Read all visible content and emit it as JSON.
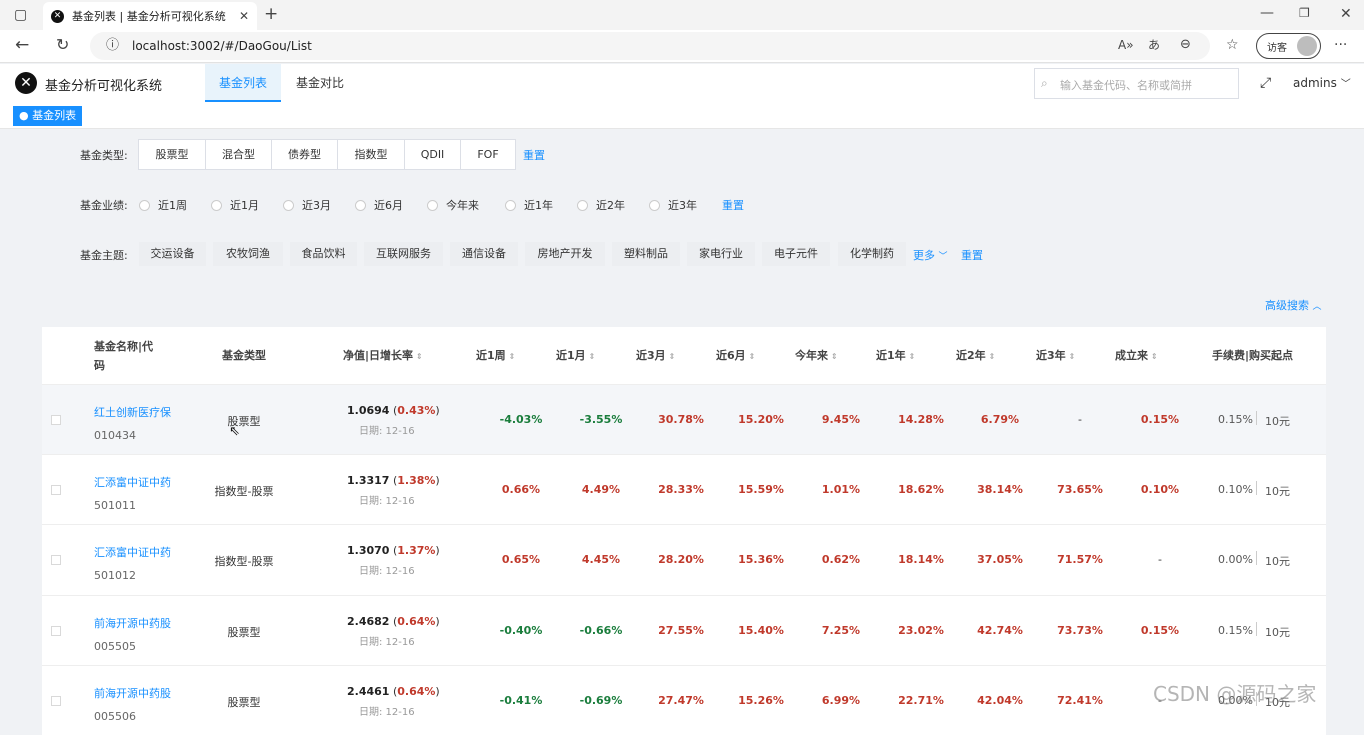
{
  "browser": {
    "tab_title": "基金列表 | 基金分析可视化系统",
    "url": "localhost:3002/#/DaoGou/List",
    "guest_label": "访客"
  },
  "app": {
    "title": "基金分析可视化系统",
    "nav": [
      "基金列表",
      "基金对比"
    ],
    "search_placeholder": "输入基金代码、名称或简拼",
    "user": "admins",
    "breadcrumb": "● 基金列表"
  },
  "filters": {
    "type_label": "基金类型:",
    "types": [
      "股票型",
      "混合型",
      "债券型",
      "指数型",
      "QDII",
      "FOF"
    ],
    "reset": "重置",
    "perf_label": "基金业绩:",
    "periods": [
      "近1周",
      "近1月",
      "近3月",
      "近6月",
      "今年来",
      "近1年",
      "近2年",
      "近3年"
    ],
    "theme_label": "基金主题:",
    "themes": [
      "交运设备",
      "农牧饲渔",
      "食品饮料",
      "互联网服务",
      "通信设备",
      "房地产开发",
      "塑料制品",
      "家电行业",
      "电子元件",
      "化学制药"
    ],
    "more": "更多",
    "advanced": "高级搜索"
  },
  "table": {
    "headers": [
      "基金名称|代",
      "码",
      "基金类型",
      "净值|日增长率",
      "近1周",
      "近1月",
      "近3月",
      "近6月",
      "今年来",
      "近1年",
      "近2年",
      "近3年",
      "成立来",
      "手续费|购买起点"
    ],
    "rows": [
      {
        "name": "红土创新医疗保",
        "code": "010434",
        "type": "股票型",
        "nav": "1.0694",
        "chg": "0.43%",
        "date": "日期: 12-16",
        "w1": "-4.03%",
        "m1": "-3.55%",
        "m3": "30.78%",
        "m6": "15.20%",
        "ytd": "9.45%",
        "y1": "14.28%",
        "y2": "6.79%",
        "y3": "-",
        "since": "0.15%",
        "fee": "0.15%",
        "min": "10元"
      },
      {
        "name": "汇添富中证中药",
        "code": "501011",
        "type": "指数型-股票",
        "nav": "1.3317",
        "chg": "1.38%",
        "date": "日期: 12-16",
        "w1": "0.66%",
        "m1": "4.49%",
        "m3": "28.33%",
        "m6": "15.59%",
        "ytd": "1.01%",
        "y1": "18.62%",
        "y2": "38.14%",
        "y3": "73.65%",
        "since": "0.10%",
        "fee": "0.10%",
        "min": "10元"
      },
      {
        "name": "汇添富中证中药",
        "code": "501012",
        "type": "指数型-股票",
        "nav": "1.3070",
        "chg": "1.37%",
        "date": "日期: 12-16",
        "w1": "0.65%",
        "m1": "4.45%",
        "m3": "28.20%",
        "m6": "15.36%",
        "ytd": "0.62%",
        "y1": "18.14%",
        "y2": "37.05%",
        "y3": "71.57%",
        "since": "-",
        "fee": "0.00%",
        "min": "10元"
      },
      {
        "name": "前海开源中药股",
        "code": "005505",
        "type": "股票型",
        "nav": "2.4682",
        "chg": "0.64%",
        "date": "日期: 12-16",
        "w1": "-0.40%",
        "m1": "-0.66%",
        "m3": "27.55%",
        "m6": "15.40%",
        "ytd": "7.25%",
        "y1": "23.02%",
        "y2": "42.74%",
        "y3": "73.73%",
        "since": "0.15%",
        "fee": "0.15%",
        "min": "10元"
      },
      {
        "name": "前海开源中药股",
        "code": "005506",
        "type": "股票型",
        "nav": "2.4461",
        "chg": "0.64%",
        "date": "日期: 12-16",
        "w1": "-0.41%",
        "m1": "-0.69%",
        "m3": "27.47%",
        "m6": "15.26%",
        "ytd": "6.99%",
        "y1": "22.71%",
        "y2": "42.04%",
        "y3": "72.41%",
        "since": "-",
        "fee": "0.00%",
        "min": "10元"
      }
    ]
  },
  "watermark": "CSDN @源码之家",
  "colors": {
    "accent": "#1890ff",
    "up": "#c0392b",
    "down": "#1a7d3c"
  }
}
